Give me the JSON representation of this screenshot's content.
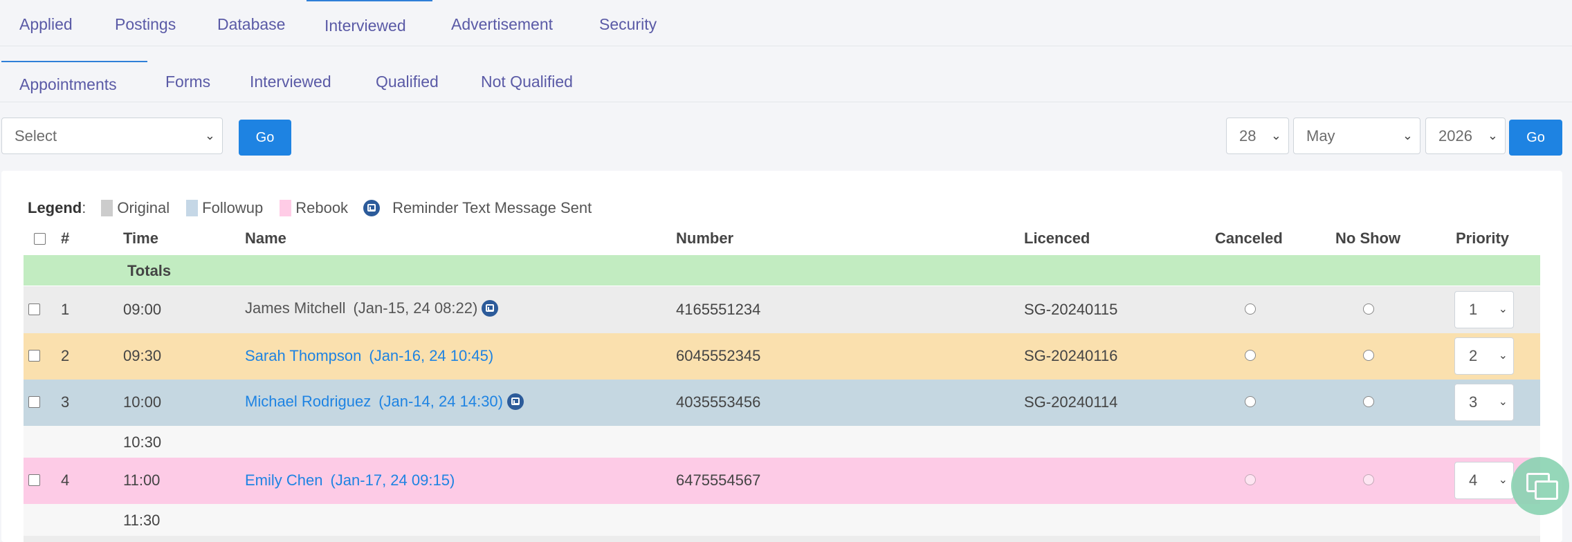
{
  "top_tabs": [
    "Applied",
    "Postings",
    "Database",
    "Interviewed",
    "Advertisement",
    "Security"
  ],
  "sub_tabs": [
    "Appointments",
    "Forms",
    "Interviewed",
    "Qualified",
    "Not Qualified"
  ],
  "filter": {
    "select_value": "Select",
    "go_label": "Go"
  },
  "date_picker": {
    "day": "28",
    "month": "May",
    "year": "2026",
    "go_label": "Go"
  },
  "legend": {
    "label": "Legend",
    "original": "Original",
    "followup": "Followup",
    "rebook": "Rebook",
    "reminder": "Reminder Text Message Sent",
    "colors": {
      "original": "#cccccc",
      "followup": "#c5d7e6",
      "rebook": "#ffcce6",
      "reminder": "#2c5b9a"
    }
  },
  "table": {
    "headers": {
      "num": "#",
      "time": "Time",
      "name": "Name",
      "number": "Number",
      "licenced": "Licenced",
      "canceled": "Canceled",
      "no_show": "No Show",
      "priority": "Priority"
    },
    "totals_label": "Totals",
    "rows": [
      {
        "num": "1",
        "time": "09:00",
        "name": "James Mitchell",
        "stamp": "(Jan-15, 24 08:22)",
        "number": "4165551234",
        "licenced": "SG-20240115",
        "priority": "1",
        "color": "#ececec",
        "reminder": true
      },
      {
        "num": "2",
        "time": "09:30",
        "name": "Sarah Thompson",
        "stamp": "(Jan-16, 24 10:45)",
        "number": "6045552345",
        "licenced": "SG-20240116",
        "priority": "2",
        "color": "#fae0ae",
        "reminder": false
      },
      {
        "num": "3",
        "time": "10:00",
        "name": "Michael Rodriguez",
        "stamp": "(Jan-14, 24 14:30)",
        "number": "4035553456",
        "licenced": "SG-20240114",
        "priority": "3",
        "color": "#c5d7e1",
        "reminder": true
      },
      {
        "time": "10:30",
        "empty": true
      },
      {
        "num": "4",
        "time": "11:00",
        "name": "Emily Chen",
        "stamp": "(Jan-17, 24 09:15)",
        "number": "6475554567",
        "licenced": "",
        "priority": "4",
        "color": "#fdcbe6",
        "reminder": false
      },
      {
        "time": "11:30",
        "empty": true
      }
    ]
  }
}
